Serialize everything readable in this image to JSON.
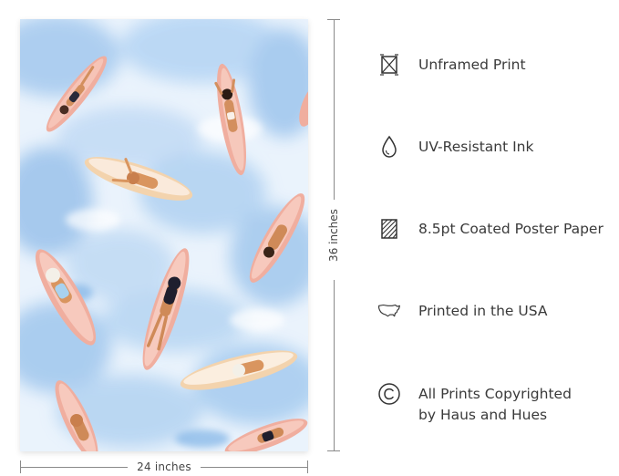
{
  "dimensions": {
    "width_label": "24 inches",
    "height_label": "36 inches"
  },
  "features": [
    {
      "icon": "unframed-icon",
      "lines": [
        "Unframed Print"
      ]
    },
    {
      "icon": "ink-drop-icon",
      "lines": [
        "UV-Resistant Ink"
      ]
    },
    {
      "icon": "paper-icon",
      "lines": [
        "8.5pt Coated Poster Paper"
      ]
    },
    {
      "icon": "usa-map-icon",
      "lines": [
        "Printed in the USA"
      ]
    },
    {
      "icon": "copyright-icon",
      "lines": [
        "All Prints Copyrighted",
        "by Haus and Hues"
      ]
    }
  ],
  "colors": {
    "water_light": "#e9f2fb",
    "water_blue": "#a9cdf0",
    "board_pink": "#f2b2a3",
    "board_cream": "#f4d6b0",
    "skin": "#d7925f",
    "swimsuit_dark": "#2a2a3a",
    "text": "#3a3a3a"
  }
}
